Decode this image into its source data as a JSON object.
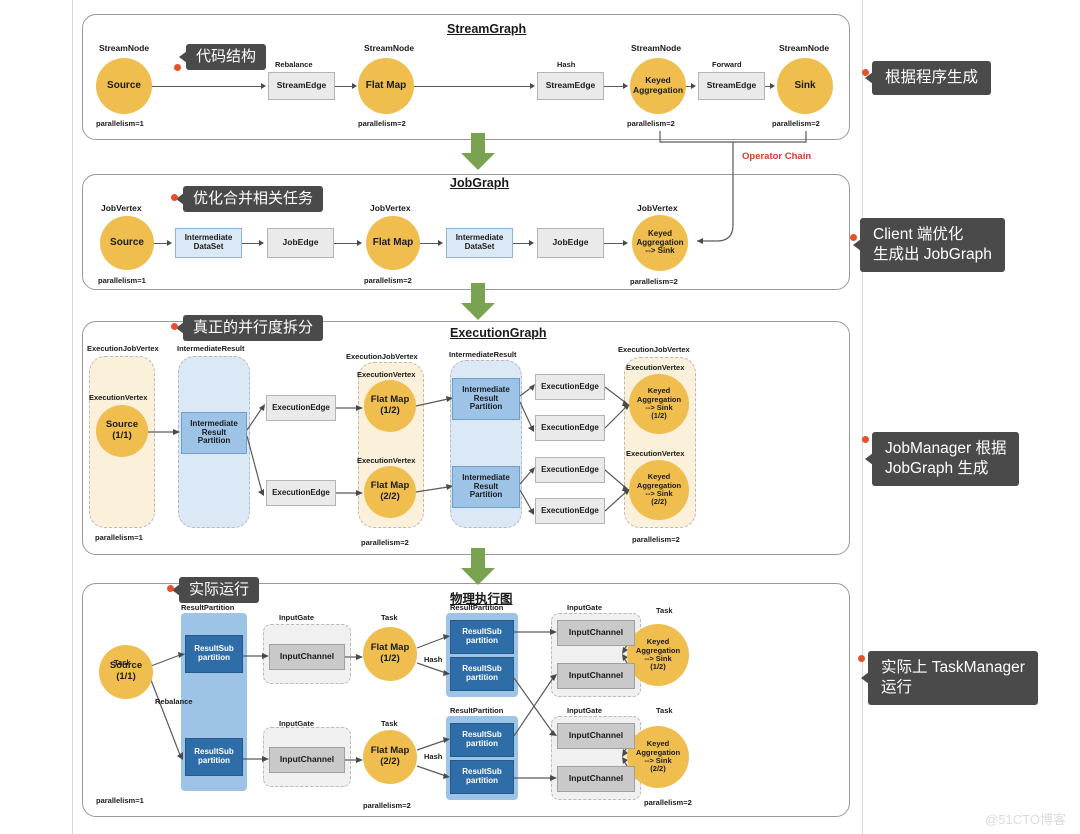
{
  "watermark": "@51CTO博客",
  "operator_chain_label": "Operator Chain",
  "stages": [
    {
      "id": "streamgraph",
      "title": "StreamGraph",
      "inner_callout": "代码结构",
      "side_callout": "根据程序生成",
      "nodes": [
        {
          "kind": "circle",
          "label": "Source",
          "cap": "StreamNode",
          "parallelism": "parallelism=1"
        },
        {
          "kind": "box",
          "label": "StreamEdge",
          "cap": "Rebalance"
        },
        {
          "kind": "circle",
          "label": "Flat Map",
          "cap": "StreamNode",
          "parallelism": "parallelism=2"
        },
        {
          "kind": "box",
          "label": "StreamEdge",
          "cap": "Hash"
        },
        {
          "kind": "circle",
          "label": "Keyed\nAggregation",
          "cap": "StreamNode",
          "parallelism": "parallelism=2"
        },
        {
          "kind": "box",
          "label": "StreamEdge",
          "cap": "Forward"
        },
        {
          "kind": "circle",
          "label": "Sink",
          "cap": "StreamNode",
          "parallelism": "parallelism=2"
        }
      ]
    },
    {
      "id": "jobgraph",
      "title": "JobGraph",
      "inner_callout": "优化合并相关任务",
      "side_callout": "Client 端优化\n生成出 JobGraph",
      "nodes": [
        {
          "kind": "circle",
          "label": "Source",
          "cap": "JobVertex",
          "parallelism": "parallelism=1"
        },
        {
          "kind": "box",
          "label": "Intermediate\nDataSet"
        },
        {
          "kind": "box",
          "label": "JobEdge"
        },
        {
          "kind": "circle",
          "label": "Flat Map",
          "cap": "JobVertex",
          "parallelism": "parallelism=2"
        },
        {
          "kind": "box",
          "label": "Intermediate\nDataSet"
        },
        {
          "kind": "box",
          "label": "JobEdge"
        },
        {
          "kind": "circle",
          "label": "Keyed\nAggregation\n--> Sink",
          "cap": "JobVertex",
          "parallelism": "parallelism=2"
        }
      ]
    },
    {
      "id": "executiongraph",
      "title": "ExecutionGraph",
      "inner_callout": "真正的并行度拆分",
      "side_callout": "JobManager 根据\nJobGraph 生成",
      "groups": [
        {
          "cap": "ExecutionJobVertex",
          "parallelism": "parallelism=1"
        },
        {
          "cap": "IntermediateResult"
        },
        {
          "cap": "ExecutionJobVertex",
          "parallelism": "parallelism=2"
        },
        {
          "cap": "IntermediateResult"
        },
        {
          "cap": "ExecutionJobVertex",
          "parallelism": "parallelism=2"
        }
      ],
      "vertex_caption": "ExecutionVertex",
      "edge_label": "ExecutionEdge",
      "partition_label": "Intermediate\nResult\nPartition",
      "nodes": [
        {
          "label": "Source\n(1/1)"
        },
        {
          "label": "Flat Map\n(1/2)"
        },
        {
          "label": "Flat Map\n(2/2)"
        },
        {
          "label": "Keyed\nAggregation\n--> Sink\n(1/2)"
        },
        {
          "label": "Keyed\nAggregation\n--> Sink\n(2/2)"
        }
      ]
    },
    {
      "id": "physicalgraph",
      "title": "物理执行图",
      "inner_callout": "实际运行",
      "side_callout": "实际上 TaskManager\n运行",
      "task_caption": "Task",
      "result_partition_caption": "ResultPartition",
      "input_gate_caption": "InputGate",
      "subpartition_label": "ResultSub\npartition",
      "input_channel_label": "InputChannel",
      "rebalance_label": "Rebalance",
      "hash_label": "Hash",
      "parallelism_1": "parallelism=1",
      "parallelism_2a": "parallelism=2",
      "parallelism_2b": "parallelism=2",
      "nodes": [
        {
          "label": "Source\n(1/1)"
        },
        {
          "label": "Flat Map\n(1/2)"
        },
        {
          "label": "Flat Map\n(2/2)"
        },
        {
          "label": "Keyed\nAggregation\n--> Sink\n(1/2)"
        },
        {
          "label": "Keyed\nAggregation\n--> Sink\n(2/2)"
        }
      ]
    }
  ],
  "colors": {
    "node_orange": "#efbe4f",
    "group_cream": "#fbf0d9",
    "light_blue": "#dbe9f7",
    "mid_blue": "#9dc3e6",
    "dark_blue": "#2e6da8",
    "gray_box": "#eaeaea",
    "green_arrow": "#7aa351",
    "callout_bg": "#4a4a4a",
    "dot_red": "#e8502b",
    "operator_chain_red": "#d83a2e"
  }
}
